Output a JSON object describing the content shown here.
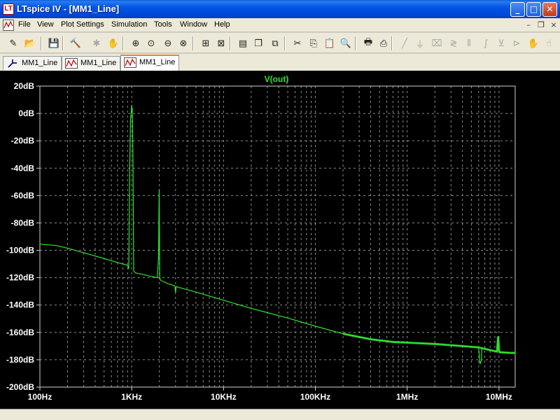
{
  "window": {
    "title": "LTspice IV - [MM1_Line]",
    "icon_glyph": "LT",
    "controls": {
      "minimize": "_",
      "maximize": "□",
      "close": "✕"
    }
  },
  "menu": {
    "items": [
      {
        "label": "File"
      },
      {
        "label": "View"
      },
      {
        "label": "Plot Settings"
      },
      {
        "label": "Simulation"
      },
      {
        "label": "Tools"
      },
      {
        "label": "Window"
      },
      {
        "label": "Help"
      }
    ],
    "mdi_controls": {
      "minimize": "–",
      "restore": "❐",
      "close": "×"
    }
  },
  "toolbar": {
    "icons": [
      {
        "name": "new-schematic-icon",
        "glyph": "✎",
        "dim": false
      },
      {
        "name": "open-icon",
        "glyph": "📂",
        "dim": false
      },
      {
        "name": "save-icon",
        "glyph": "💾",
        "dim": false
      },
      {
        "name": "control-panel-icon",
        "glyph": "🔨",
        "dim": false
      },
      {
        "name": "run-icon",
        "glyph": "✱",
        "dim": true
      },
      {
        "name": "pan-icon",
        "glyph": "✋",
        "dim": true
      },
      {
        "name": "zoom-in-icon",
        "glyph": "⊕",
        "dim": false
      },
      {
        "name": "zoom-pan-icon",
        "glyph": "⊙",
        "dim": false
      },
      {
        "name": "zoom-out-icon",
        "glyph": "⊖",
        "dim": false
      },
      {
        "name": "zoom-fit-icon",
        "glyph": "⊗",
        "dim": false
      },
      {
        "name": "autorange-icon",
        "glyph": "⊞",
        "dim": false
      },
      {
        "name": "pick-traces-icon",
        "glyph": "⊠",
        "dim": false
      },
      {
        "name": "tile-horizontal-icon",
        "glyph": "▤",
        "dim": false
      },
      {
        "name": "cascade-icon",
        "glyph": "❐",
        "dim": false
      },
      {
        "name": "close-all-icon",
        "glyph": "⧉",
        "dim": false
      },
      {
        "name": "cut-icon",
        "glyph": "✂",
        "dim": false
      },
      {
        "name": "copy-icon",
        "glyph": "⎘",
        "dim": false
      },
      {
        "name": "paste-icon",
        "glyph": "📋",
        "dim": false
      },
      {
        "name": "find-icon",
        "glyph": "🔍",
        "dim": false
      },
      {
        "name": "print-setup-icon",
        "glyph": "🖶",
        "dim": false
      },
      {
        "name": "print-icon",
        "glyph": "⎙",
        "dim": false
      },
      {
        "name": "wire-icon",
        "glyph": "╱",
        "dim": true
      },
      {
        "name": "ground-icon",
        "glyph": "⏚",
        "dim": true
      },
      {
        "name": "label-icon",
        "glyph": "⌧",
        "dim": true
      },
      {
        "name": "resistor-icon",
        "glyph": "≷",
        "dim": true
      },
      {
        "name": "capacitor-icon",
        "glyph": "⫴",
        "dim": true
      },
      {
        "name": "inductor-icon",
        "glyph": "∫",
        "dim": true
      },
      {
        "name": "diode-icon",
        "glyph": "⊻",
        "dim": true
      },
      {
        "name": "component-icon",
        "glyph": "⊳",
        "dim": true
      },
      {
        "name": "move-icon",
        "glyph": "✋",
        "dim": true
      },
      {
        "name": "drag-icon",
        "glyph": "☝",
        "dim": true
      }
    ]
  },
  "tabs": [
    {
      "label": "MM1_Line",
      "kind": "schematic",
      "active": false
    },
    {
      "label": "MM1_Line",
      "kind": "waveform",
      "active": false
    },
    {
      "label": "MM1_Line",
      "kind": "waveform",
      "active": true
    }
  ],
  "colors": {
    "trace": "#2ee62e",
    "grid": "#8c8c8c",
    "frame": "#d0d0d0",
    "label_text": "#ffffff",
    "background": "#000000"
  },
  "chart_data": {
    "type": "line",
    "title": "V(out)",
    "xlabel": "",
    "ylabel": "",
    "x_scale": "log",
    "x_range": [
      100,
      15000000
    ],
    "y_range": [
      -200,
      20
    ],
    "x_ticks": [
      {
        "value": 100,
        "label": "100Hz"
      },
      {
        "value": 1000,
        "label": "1KHz"
      },
      {
        "value": 10000,
        "label": "10KHz"
      },
      {
        "value": 100000,
        "label": "100KHz"
      },
      {
        "value": 1000000,
        "label": "1MHz"
      },
      {
        "value": 10000000,
        "label": "10MHz"
      }
    ],
    "y_ticks": [
      {
        "value": 20,
        "label": "20dB"
      },
      {
        "value": 0,
        "label": "0dB"
      },
      {
        "value": -20,
        "label": "-20dB"
      },
      {
        "value": -40,
        "label": "-40dB"
      },
      {
        "value": -60,
        "label": "-60dB"
      },
      {
        "value": -80,
        "label": "-80dB"
      },
      {
        "value": -100,
        "label": "-100dB"
      },
      {
        "value": -120,
        "label": "-120dB"
      },
      {
        "value": -140,
        "label": "-140dB"
      },
      {
        "value": -160,
        "label": "-160dB"
      },
      {
        "value": -180,
        "label": "-180dB"
      },
      {
        "value": -200,
        "label": "-200dB"
      }
    ],
    "grid": true,
    "series": [
      {
        "name": "V(out)",
        "x": [
          100,
          150,
          200,
          300,
          500,
          700,
          900,
          930,
          950,
          970,
          990,
          1000,
          1015,
          1030,
          1050,
          1080,
          1100,
          1300,
          1600,
          1900,
          1960,
          1990,
          2005,
          2020,
          2060,
          2150,
          2500,
          2950,
          3000,
          3050,
          3200,
          5000,
          10000,
          20000,
          50000,
          100000,
          200000,
          400000,
          700000,
          1000000,
          2000000,
          4000000,
          6000000,
          6200000,
          6300000,
          6400000,
          6500000,
          7000000,
          8000000,
          9500000,
          9800000,
          10000000,
          10200000,
          10500000,
          13000000,
          15000000
        ],
        "y": [
          -95.5,
          -96.5,
          -98.5,
          -101.8,
          -106,
          -109,
          -111,
          -113.5,
          -40,
          -5,
          2,
          6,
          3,
          -30,
          -115,
          -116,
          -116.5,
          -117.5,
          -119,
          -120,
          -105,
          -56,
          -88,
          -120,
          -122,
          -122.5,
          -124.5,
          -126,
          -131,
          -126.5,
          -127,
          -130.5,
          -136.5,
          -142.5,
          -149.5,
          -155.5,
          -161,
          -165,
          -167,
          -167.5,
          -168.5,
          -170,
          -171,
          -183,
          -182,
          -181,
          -171.5,
          -172,
          -173,
          -174,
          -163,
          -173.5,
          -174.5,
          -174.5,
          -175,
          -175
        ]
      }
    ]
  }
}
